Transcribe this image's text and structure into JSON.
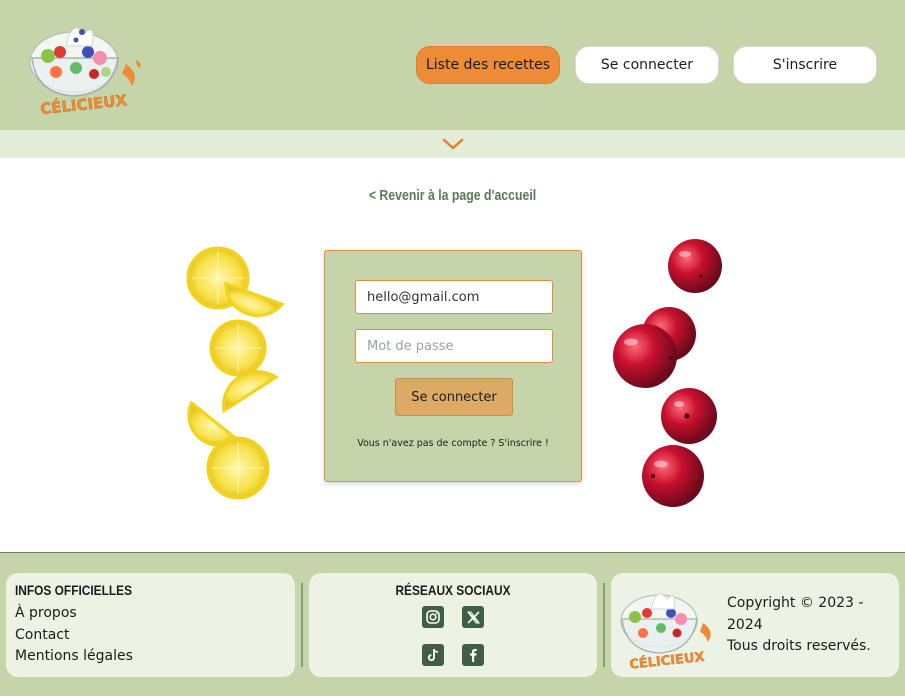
{
  "header": {
    "logo_text": "CÉLICIEUX",
    "nav": {
      "recipes": "Liste des recettes",
      "login": "Se connecter",
      "signup": "S'inscrire"
    }
  },
  "main": {
    "back_link": "< Revenir à la page d'accueil",
    "form": {
      "email_value": "hello@gmail.com",
      "password_placeholder": "Mot de passe",
      "submit": "Se connecter",
      "no_account_text": "Vous n'avez pas de compte ?",
      "signup_link": "S'inscrire !"
    }
  },
  "footer": {
    "info": {
      "title": "INFOS OFFICIELLES",
      "links": [
        "À propos",
        "Contact",
        "Mentions légales"
      ]
    },
    "social": {
      "title": "RÉSEAUX SOCIAUX",
      "icons": [
        "instagram-icon",
        "x-icon",
        "tiktok-icon",
        "facebook-icon"
      ]
    },
    "copyright": {
      "line1": "Copyright © 2023 - 2024",
      "line2": "Tous droits reservés."
    }
  },
  "colors": {
    "header_bg": "#c5d5a9",
    "accent_orange": "#ee8b36",
    "submit_bg": "#ddaa66",
    "footer_card_bg": "#ecf3e4",
    "link_green": "#5c7a5a",
    "social_icon_bg": "#3f5e42"
  }
}
